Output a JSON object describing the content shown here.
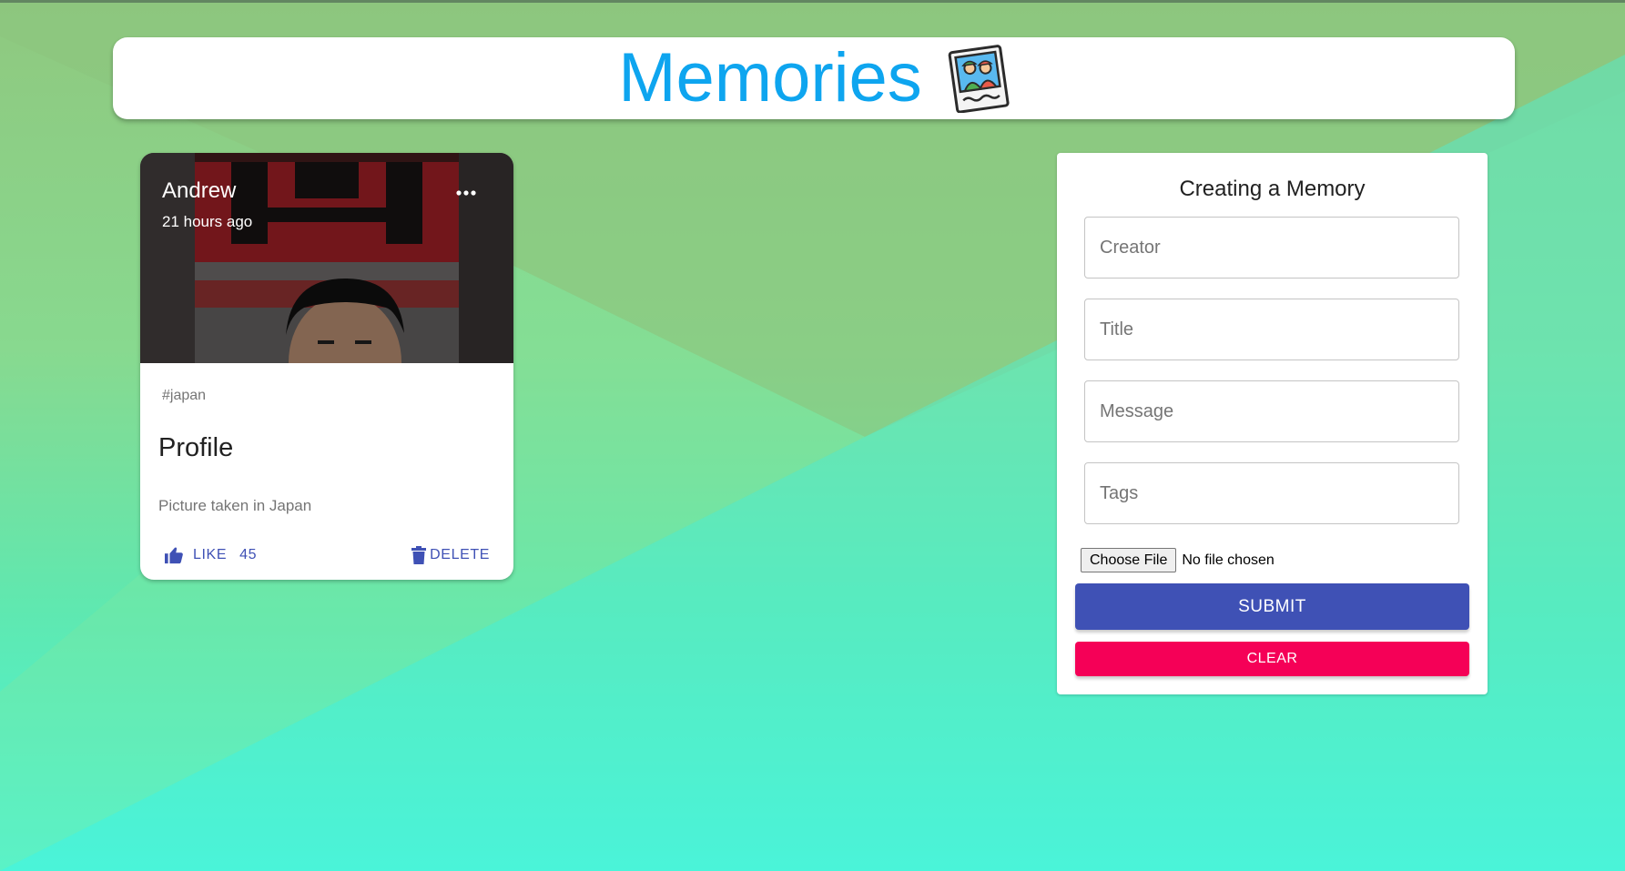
{
  "app": {
    "title": "Memories",
    "logo_icon": "memories-photo-icon"
  },
  "colors": {
    "brand": "#0ea5ef",
    "primary": "#3f51b5",
    "secondary": "#f50057"
  },
  "posts": [
    {
      "creator": "Andrew",
      "time": "21 hours ago",
      "tags": "#japan",
      "title": "Profile",
      "message": "Picture taken in Japan",
      "like_label": "LIKE",
      "like_count": "45",
      "delete_label": "DELETE",
      "more_icon": "more-horizontal-icon",
      "like_icon": "thumb-up-icon",
      "delete_icon": "trash-icon"
    }
  ],
  "form": {
    "title": "Creating a Memory",
    "fields": {
      "creator": {
        "placeholder": "Creator",
        "value": ""
      },
      "title": {
        "placeholder": "Title",
        "value": ""
      },
      "message": {
        "placeholder": "Message",
        "value": ""
      },
      "tags": {
        "placeholder": "Tags",
        "value": ""
      }
    },
    "file": {
      "button_label": "Choose File",
      "status": "No file chosen"
    },
    "submit_label": "SUBMIT",
    "clear_label": "CLEAR"
  }
}
